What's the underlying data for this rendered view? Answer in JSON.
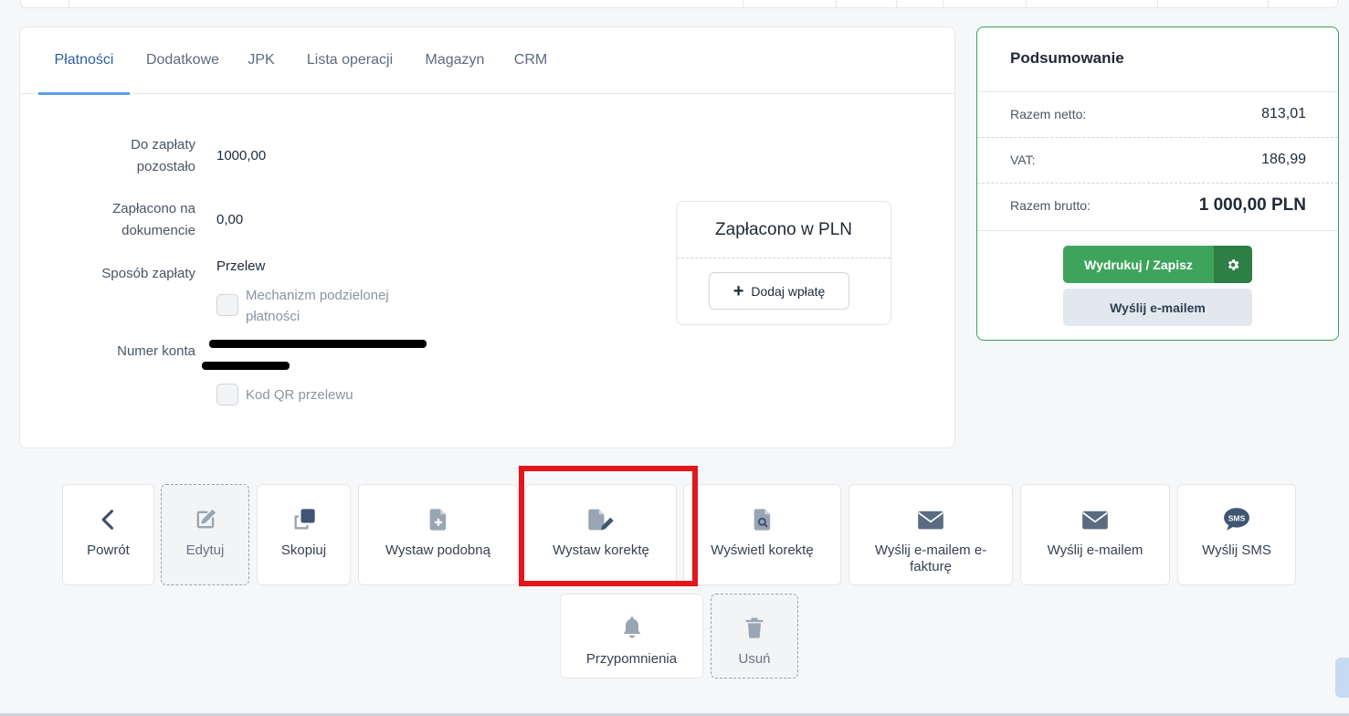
{
  "tabs": [
    {
      "label": "Płatności",
      "active": true
    },
    {
      "label": "Dodatkowe"
    },
    {
      "label": "JPK"
    },
    {
      "label": "Lista operacji"
    },
    {
      "label": "Magazyn"
    },
    {
      "label": "CRM"
    }
  ],
  "payment": {
    "due_label": "Do zapłaty pozostało",
    "due_value": "1000,00",
    "paid_label": "Zapłacono na dokumencie",
    "paid_value": "0,00",
    "method_label": "Sposób zapłaty",
    "method_value": "Przelew",
    "split_label": "Mechanizm podzielonej płatności",
    "account_label": "Numer konta",
    "qr_label": "Kod QR przelewu"
  },
  "paid_card": {
    "title": "Zapłacono w PLN",
    "add_label": "Dodaj wpłatę"
  },
  "summary": {
    "title": "Podsumowanie",
    "net_label": "Razem netto:",
    "net_value": "813,01",
    "vat_label": "VAT:",
    "vat_value": "186,99",
    "gross_label": "Razem brutto:",
    "gross_value": "1 000,00 PLN",
    "print_label": "Wydrukuj / Zapisz",
    "email_label": "Wyślij e-mailem"
  },
  "actions": {
    "back": "Powrót",
    "edit": "Edytuj",
    "copy": "Skopiuj",
    "similar": "Wystaw podobną",
    "correction": "Wystaw korektę",
    "show_correction": "Wyświetl korektę",
    "email_einvoice": "Wyślij e-mailem e-fakturę",
    "email": "Wyślij e-mailem",
    "sms": "Wyślij SMS",
    "sms_icon_text": "SMS",
    "reminders": "Przypomnienia",
    "delete": "Usuń"
  },
  "colors": {
    "accent_blue": "#2c5ea8",
    "green": "#3ea45c",
    "green_dark": "#2d7f45",
    "icon": "#5b6b82",
    "highlight_red": "#e3161c"
  }
}
